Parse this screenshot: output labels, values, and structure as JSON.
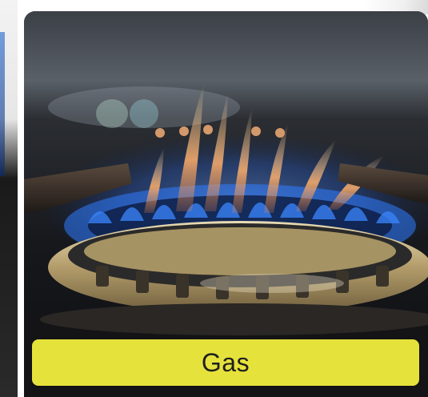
{
  "card": {
    "label": "Gas",
    "label_color": "#e6e23c",
    "label_text_color": "#1f1f1f"
  },
  "photo": {
    "icon": "gas-burner-flame-photo",
    "flame_color": "#2f7bff",
    "flame_tip_color": "#ffb566",
    "burner_color": "#c6b48a"
  }
}
